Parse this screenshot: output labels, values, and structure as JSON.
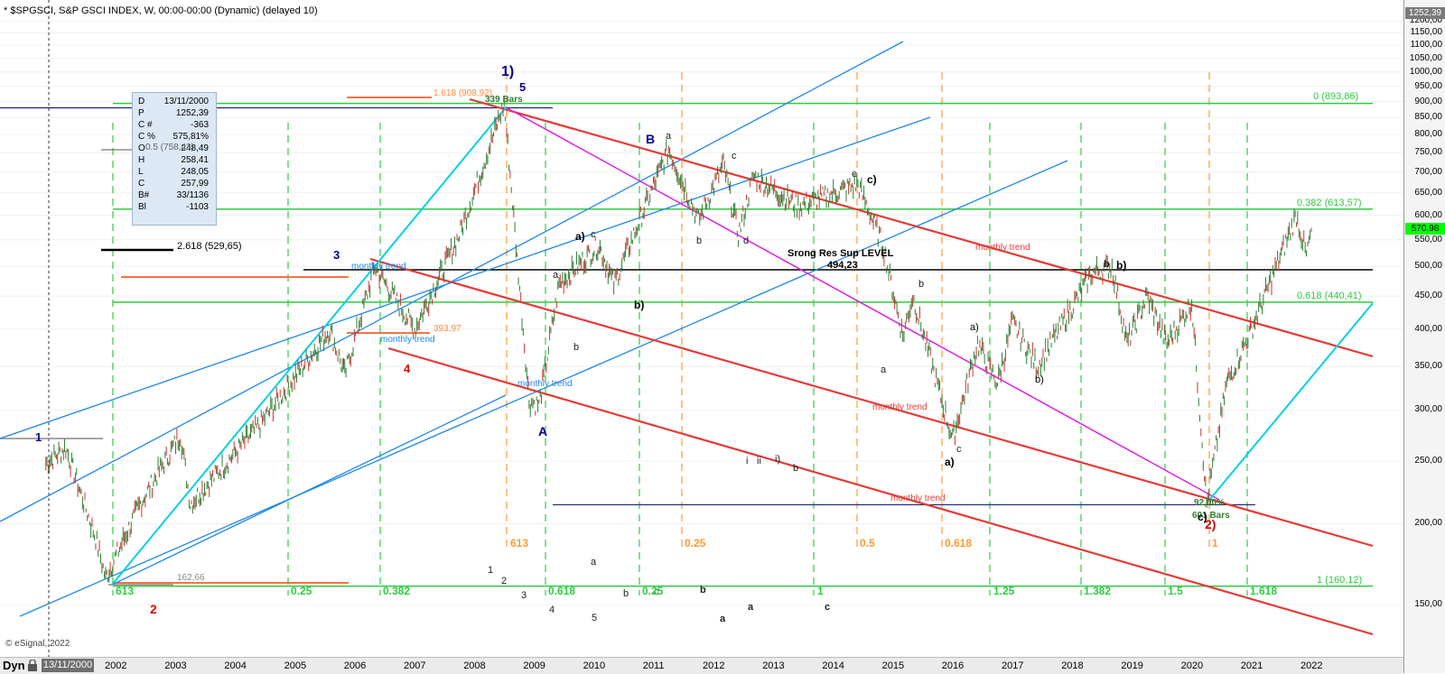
{
  "header": {
    "title": "* $SPGSCI, S&P GSCI INDEX, W, 00:00-00:00 (Dynamic) (delayed 10)"
  },
  "copyright": "© eSignal, 2022",
  "bottom_bar": {
    "mode": "Dyn",
    "cursor_date": "13/11/2000",
    "years": [
      "2002",
      "2003",
      "2004",
      "2005",
      "2006",
      "2007",
      "2008",
      "2009",
      "2010",
      "2011",
      "2012",
      "2013",
      "2014",
      "2015",
      "2016",
      "2017",
      "2018",
      "2019",
      "2020",
      "2021",
      "2022"
    ]
  },
  "price_axis": {
    "labels": [
      "1200,00",
      "1150,00",
      "1100,00",
      "1050,00",
      "1000,00",
      "950,00",
      "900,00",
      "850,00",
      "800,00",
      "750,00",
      "700,00",
      "650,00",
      "600,00",
      "550,00",
      "500,00",
      "450,00",
      "400,00",
      "350,00",
      "300,00",
      "250,00",
      "200,00",
      "150,00"
    ],
    "last_price_tag": "1252,39",
    "current_price_tag": "570,98",
    "current_tag_color": "#00ff00",
    "last_tag_color": "#7a7a7a"
  },
  "info_box": {
    "rows": [
      {
        "k": "D",
        "v": "13/11/2000"
      },
      {
        "k": "P",
        "v": "1252,39"
      },
      {
        "k": "C #",
        "v": "-363"
      },
      {
        "k": "C %",
        "v": "575,81%"
      },
      {
        "k": "O",
        "v": "248,49"
      },
      {
        "k": "H",
        "v": "258,41"
      },
      {
        "k": "L",
        "v": "248,05"
      },
      {
        "k": "C",
        "v": "257,99"
      },
      {
        "k": "B#",
        "v": "33/1136"
      },
      {
        "k": "Bl",
        "v": "-1103"
      }
    ],
    "overlay_text": "0.5 (758,43)"
  },
  "annotations": [
    {
      "id": "wave-1-top",
      "text": "1)",
      "color": "#00008b"
    },
    {
      "id": "wave-5",
      "text": "5",
      "color": "#00008b"
    },
    {
      "id": "bars-339",
      "text": "339 Bars",
      "color": "#2e7d32"
    },
    {
      "id": "fib-1618-top",
      "text": "1.618 (908,92)",
      "color": "#ff8c42"
    },
    {
      "id": "wave-B",
      "text": "B",
      "color": "#00008b"
    },
    {
      "id": "wave-A",
      "text": "A",
      "color": "#00008b"
    },
    {
      "id": "wave-3",
      "text": "3",
      "color": "#00008b"
    },
    {
      "id": "wave-1-left",
      "text": "1",
      "color": "#00008b"
    },
    {
      "id": "wave-2-left",
      "text": "2",
      "color": "#e00000"
    },
    {
      "id": "wave-4",
      "text": "4",
      "color": "#e00000"
    },
    {
      "id": "wave-2-bottom",
      "text": "2)",
      "color": "#e00000"
    },
    {
      "id": "fib-2618",
      "text": "2.618 (529,65)",
      "color": "#000000"
    },
    {
      "id": "price-162",
      "text": "162,66",
      "color": "#888888"
    },
    {
      "id": "price-393",
      "text": "393,97",
      "color": "#ff8c42"
    },
    {
      "id": "monthly-trend-1",
      "text": "monthly trend",
      "color": "#1e88e5"
    },
    {
      "id": "monthly-trend-2",
      "text": "monthly trend",
      "color": "#1e88e5"
    },
    {
      "id": "monthly-trend-3",
      "text": "monthly trend",
      "color": "#1e88e5"
    },
    {
      "id": "monthly-trend-4",
      "text": "monthly trend",
      "color": "#e53935"
    },
    {
      "id": "monthly-trend-5",
      "text": "monthly trend",
      "color": "#e53935"
    },
    {
      "id": "monthly-trend-6",
      "text": "monthly trend",
      "color": "#e53935"
    },
    {
      "id": "strong-res",
      "text": "Srong Res Sup LEVEL",
      "color": "#000000"
    },
    {
      "id": "strong-res-val",
      "text": "494,23",
      "color": "#000000"
    },
    {
      "id": "fib-0-right",
      "text": "0 (893,86)",
      "color": "#2ecc40"
    },
    {
      "id": "fib-382-right",
      "text": "0.382 (613,57)",
      "color": "#2ecc40"
    },
    {
      "id": "fib-618-right",
      "text": "0.618 (440,41)",
      "color": "#2ecc40"
    },
    {
      "id": "fib-1-right",
      "text": "1 (160,12)",
      "color": "#2ecc40"
    },
    {
      "id": "pct-92",
      "text": "92,00%",
      "color": "#2e7d32"
    },
    {
      "id": "bars-601",
      "text": "601 Bars",
      "color": "#2e7d32"
    },
    {
      "id": "wc-1",
      "text": "a)",
      "color": "#000000"
    },
    {
      "id": "wc-2",
      "text": "b)",
      "color": "#000000"
    },
    {
      "id": "wc-3",
      "text": "c)",
      "color": "#000000"
    },
    {
      "id": "wc-4",
      "text": "a)",
      "color": "#000000"
    },
    {
      "id": "wc-5",
      "text": "b)",
      "color": "#000000"
    },
    {
      "id": "wc-6",
      "text": "a)",
      "color": "#000000"
    },
    {
      "id": "wc-7",
      "text": "b)",
      "color": "#000000"
    },
    {
      "id": "wc-8",
      "text": "c)",
      "color": "#000000"
    }
  ],
  "small_labels": [
    "a",
    "b",
    "c",
    "d",
    "e",
    "a",
    "b",
    "c",
    "a",
    "b",
    "c",
    "a",
    "b",
    "c",
    "1",
    "2",
    "3",
    "4",
    "5",
    "i",
    "ii",
    "i)",
    "b",
    "a",
    "b",
    "a",
    "b",
    "c"
  ],
  "time_fib_labels_orange": [
    "613",
    "0.25",
    "0.5",
    "0.618",
    "1"
  ],
  "time_fib_labels_green": [
    "613",
    "0.25",
    "0.382",
    "0.618",
    "0.25",
    "1",
    "1.25",
    "1.382",
    "1.5",
    "1.618"
  ],
  "chart_data": {
    "type": "line",
    "series": [
      {
        "values_weekly_approx": [
          {
            "x": "2000-11",
            "y": 248
          },
          {
            "x": "2001-03",
            "y": 262
          },
          {
            "x": "2001-09",
            "y": 190
          },
          {
            "x": "2001-11",
            "y": 165
          },
          {
            "x": "2002-06",
            "y": 215
          },
          {
            "x": "2003-02",
            "y": 275
          },
          {
            "x": "2003-04",
            "y": 215
          },
          {
            "x": "2004-06",
            "y": 285
          },
          {
            "x": "2005-08",
            "y": 400
          },
          {
            "x": "2005-11",
            "y": 340
          },
          {
            "x": "2006-05",
            "y": 500
          },
          {
            "x": "2007-01",
            "y": 400
          },
          {
            "x": "2007-10",
            "y": 560
          },
          {
            "x": "2008-07",
            "y": 894
          },
          {
            "x": "2008-12",
            "y": 310
          },
          {
            "x": "2009-02",
            "y": 305
          },
          {
            "x": "2009-06",
            "y": 470
          },
          {
            "x": "2010-02",
            "y": 540
          },
          {
            "x": "2010-05",
            "y": 470
          },
          {
            "x": "2011-04",
            "y": 760
          },
          {
            "x": "2011-10",
            "y": 590
          },
          {
            "x": "2012-03",
            "y": 720
          },
          {
            "x": "2012-06",
            "y": 560
          },
          {
            "x": "2012-09",
            "y": 690
          },
          {
            "x": "2013-06",
            "y": 620
          },
          {
            "x": "2014-06",
            "y": 670
          },
          {
            "x": "2014-11",
            "y": 540
          },
          {
            "x": "2015-03",
            "y": 390
          },
          {
            "x": "2015-05",
            "y": 450
          },
          {
            "x": "2016-01",
            "y": 270
          },
          {
            "x": "2016-06",
            "y": 380
          },
          {
            "x": "2016-10",
            "y": 330
          },
          {
            "x": "2017-01",
            "y": 410
          },
          {
            "x": "2017-06",
            "y": 350
          },
          {
            "x": "2018-05",
            "y": 490
          },
          {
            "x": "2018-09",
            "y": 500
          },
          {
            "x": "2018-12",
            "y": 380
          },
          {
            "x": "2019-04",
            "y": 450
          },
          {
            "x": "2019-08",
            "y": 380
          },
          {
            "x": "2020-01",
            "y": 440
          },
          {
            "x": "2020-04",
            "y": 215
          },
          {
            "x": "2020-08",
            "y": 330
          },
          {
            "x": "2021-01",
            "y": 400
          },
          {
            "x": "2021-10",
            "y": 600
          },
          {
            "x": "2021-12",
            "y": 520
          },
          {
            "x": "2022-01",
            "y": 570
          }
        ]
      }
    ],
    "yscale": "log",
    "ylim": [
      140,
      1250
    ],
    "xlim": [
      "2000-11",
      "2022-01"
    ],
    "horizontal_levels": [
      {
        "name": "0 (893,86)",
        "y": 893.86,
        "color": "#2ecc40"
      },
      {
        "name": "0.382 (613,57)",
        "y": 613.57,
        "color": "#2ecc40"
      },
      {
        "name": "0.618 (440,41)",
        "y": 440.41,
        "color": "#2ecc40"
      },
      {
        "name": "1 (160,12)",
        "y": 160.12,
        "color": "#2ecc40"
      },
      {
        "name": "Srong Res Sup LEVEL 494,23",
        "y": 494.23,
        "color": "#000000"
      }
    ]
  }
}
